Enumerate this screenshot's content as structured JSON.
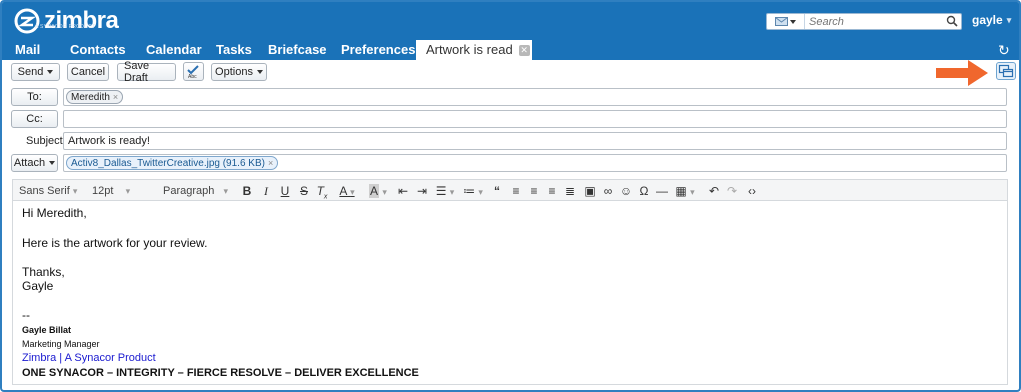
{
  "app": {
    "brand": "zimbra",
    "brand_sub": "A SYNACOR PRODUCT",
    "accent_color": "#1a72b8",
    "arrow_color": "#f0672d"
  },
  "header": {
    "search_placeholder": "Search",
    "user": "gayle"
  },
  "nav": {
    "items": [
      "Mail",
      "Contacts",
      "Calendar",
      "Tasks",
      "Briefcase",
      "Preferences"
    ],
    "active_tab": "Artwork is read"
  },
  "toolbar": {
    "send": "Send",
    "cancel": "Cancel",
    "save_draft": "Save Draft",
    "spell_icon": "spellcheck-icon",
    "options": "Options",
    "new_window_icon": "new-window-icon"
  },
  "compose": {
    "to_label": "To:",
    "to_chips": [
      "Meredith"
    ],
    "cc_label": "Cc:",
    "subject_label": "Subject:",
    "subject_value": "Artwork is ready!",
    "attach_label": "Attach",
    "attachments": [
      "Activ8_Dallas_TwitterCreative.jpg (91.6 KB)"
    ]
  },
  "editor_toolbar": {
    "font_family": "Sans Serif",
    "font_size": "12pt",
    "block_format": "Paragraph"
  },
  "body": {
    "greeting": "Hi Meredith,",
    "line1": "Here is the artwork for your review.",
    "thanks": "Thanks,",
    "name": "Gayle",
    "dashes": "--",
    "sig_name": "Gayle Billat",
    "sig_title": "Marketing Manager",
    "sig_link": "Zimbra | A Synacor Product",
    "sig_motto": "ONE SYNACOR – INTEGRITY – FIERCE RESOLVE – DELIVER EXCELLENCE"
  }
}
